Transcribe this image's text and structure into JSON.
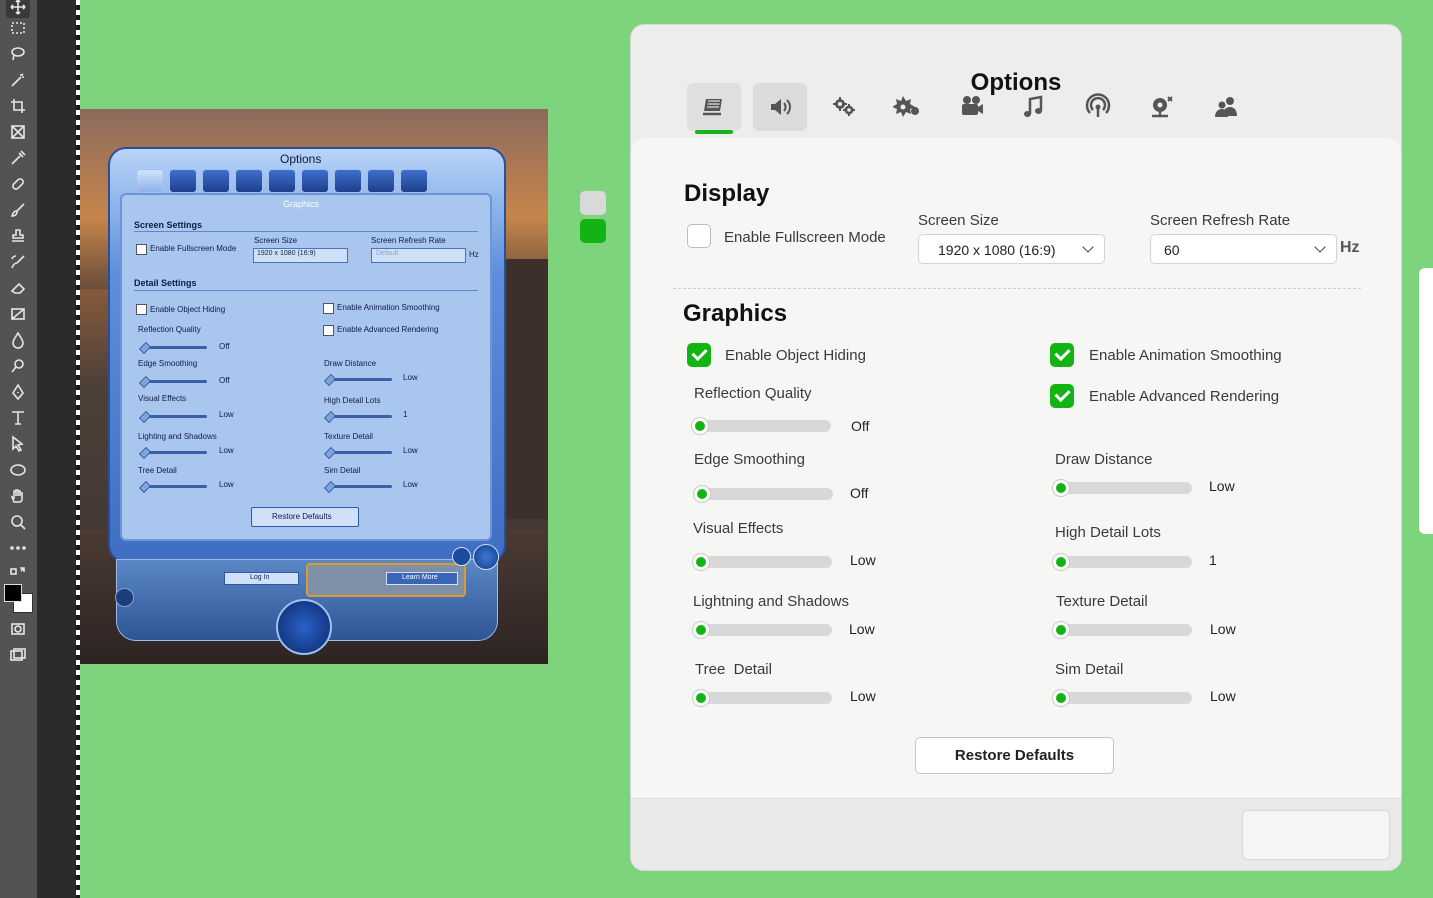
{
  "editor": {
    "tools": [
      "move-tool",
      "marquee-tool",
      "lasso-tool",
      "magic-wand-tool",
      "crop-tool",
      "frame-tool",
      "eyedropper-tool",
      "healing-brush-tool",
      "brush-tool",
      "stamp-tool",
      "history-brush-tool",
      "eraser-tool",
      "gradient-tool",
      "blur-tool",
      "dodge-tool",
      "pen-tool",
      "type-tool",
      "path-selection-tool",
      "ellipse-tool",
      "hand-tool",
      "zoom-tool",
      "more-tools",
      "swap-colors",
      "foreground-color",
      "quick-mask",
      "screen-mode"
    ],
    "foreground_color": "#000000",
    "background_color": "#ffffff",
    "canvas_color": "#7dd47c",
    "swatches": [
      "#d9d9d9",
      "#14b314"
    ]
  },
  "reference": {
    "title": "Options",
    "section": "Graphics",
    "screen_settings": "Screen Settings",
    "enable_fullscreen": "Enable Fullscreen Mode",
    "screen_size_label": "Screen Size",
    "screen_size_value": "1920 x 1080 (16:9)",
    "refresh_label": "Screen Refresh Rate",
    "refresh_value": "Default",
    "hz": "Hz",
    "detail_settings": "Detail Settings",
    "enable_object_hiding": "Enable Object Hiding",
    "enable_animation_smoothing": "Enable Animation Smoothing",
    "enable_advanced_rendering": "Enable Advanced Rendering",
    "left_sliders": [
      {
        "label": "Reflection Quality",
        "value": "Off"
      },
      {
        "label": "Edge Smoothing",
        "value": "Off"
      },
      {
        "label": "Visual Effects",
        "value": "Low"
      },
      {
        "label": "Lighting and Shadows",
        "value": "Low"
      },
      {
        "label": "Tree Detail",
        "value": "Low"
      }
    ],
    "right_sliders": [
      {
        "label": "Draw Distance",
        "value": "Low"
      },
      {
        "label": "High Detail Lots",
        "value": "1"
      },
      {
        "label": "Texture Detail",
        "value": "Low"
      },
      {
        "label": "Sim Detail",
        "value": "Low"
      }
    ],
    "restore": "Restore Defaults",
    "log_in": "Log In",
    "learn_more": "Learn More"
  },
  "options": {
    "title": "Options",
    "tabs": [
      {
        "icon": "graphics-icon",
        "active": true
      },
      {
        "icon": "audio-icon",
        "active": false
      },
      {
        "icon": "game-options-icon",
        "active": false
      },
      {
        "icon": "other-settings-icon",
        "active": false
      },
      {
        "icon": "video-camera-icon",
        "active": false
      },
      {
        "icon": "music-icon",
        "active": false
      },
      {
        "icon": "broadcast-icon",
        "active": false
      },
      {
        "icon": "camera-settings-icon",
        "active": false
      },
      {
        "icon": "community-icon",
        "active": false
      }
    ],
    "accent_color": "#14b314",
    "display": {
      "heading": "Display",
      "fullscreen_label": "Enable Fullscreen Mode",
      "fullscreen_checked": false,
      "screen_size_label": "Screen Size",
      "screen_size_value": "1920 x 1080 (16:9)",
      "refresh_label": "Screen Refresh Rate",
      "refresh_value": "60",
      "hz_unit": "Hz"
    },
    "graphics": {
      "heading": "Graphics",
      "object_hiding_label": "Enable Object Hiding",
      "object_hiding_checked": true,
      "animation_smoothing_label": "Enable Animation Smoothing",
      "animation_smoothing_checked": true,
      "advanced_rendering_label": "Enable Advanced Rendering",
      "advanced_rendering_checked": true,
      "left_sliders": [
        {
          "label": "Reflection Quality",
          "value": "Off",
          "level": 0
        },
        {
          "label": "Edge Smoothing",
          "value": "Off",
          "level": 0
        },
        {
          "label": "Visual Effects",
          "value": "Low",
          "level": 0
        },
        {
          "label": "Lightning and Shadows",
          "value": "Low",
          "level": 0
        },
        {
          "label": "Tree  Detail",
          "value": "Low",
          "level": 0
        }
      ],
      "right_sliders": [
        {
          "label": "Draw Distance",
          "value": "Low",
          "level": 0
        },
        {
          "label": "High Detail Lots",
          "value": "1",
          "level": 0
        },
        {
          "label": "Texture Detail",
          "value": "Low",
          "level": 0
        },
        {
          "label": "Sim Detail",
          "value": "Low",
          "level": 0
        }
      ],
      "restore_label": "Restore Defaults"
    }
  }
}
